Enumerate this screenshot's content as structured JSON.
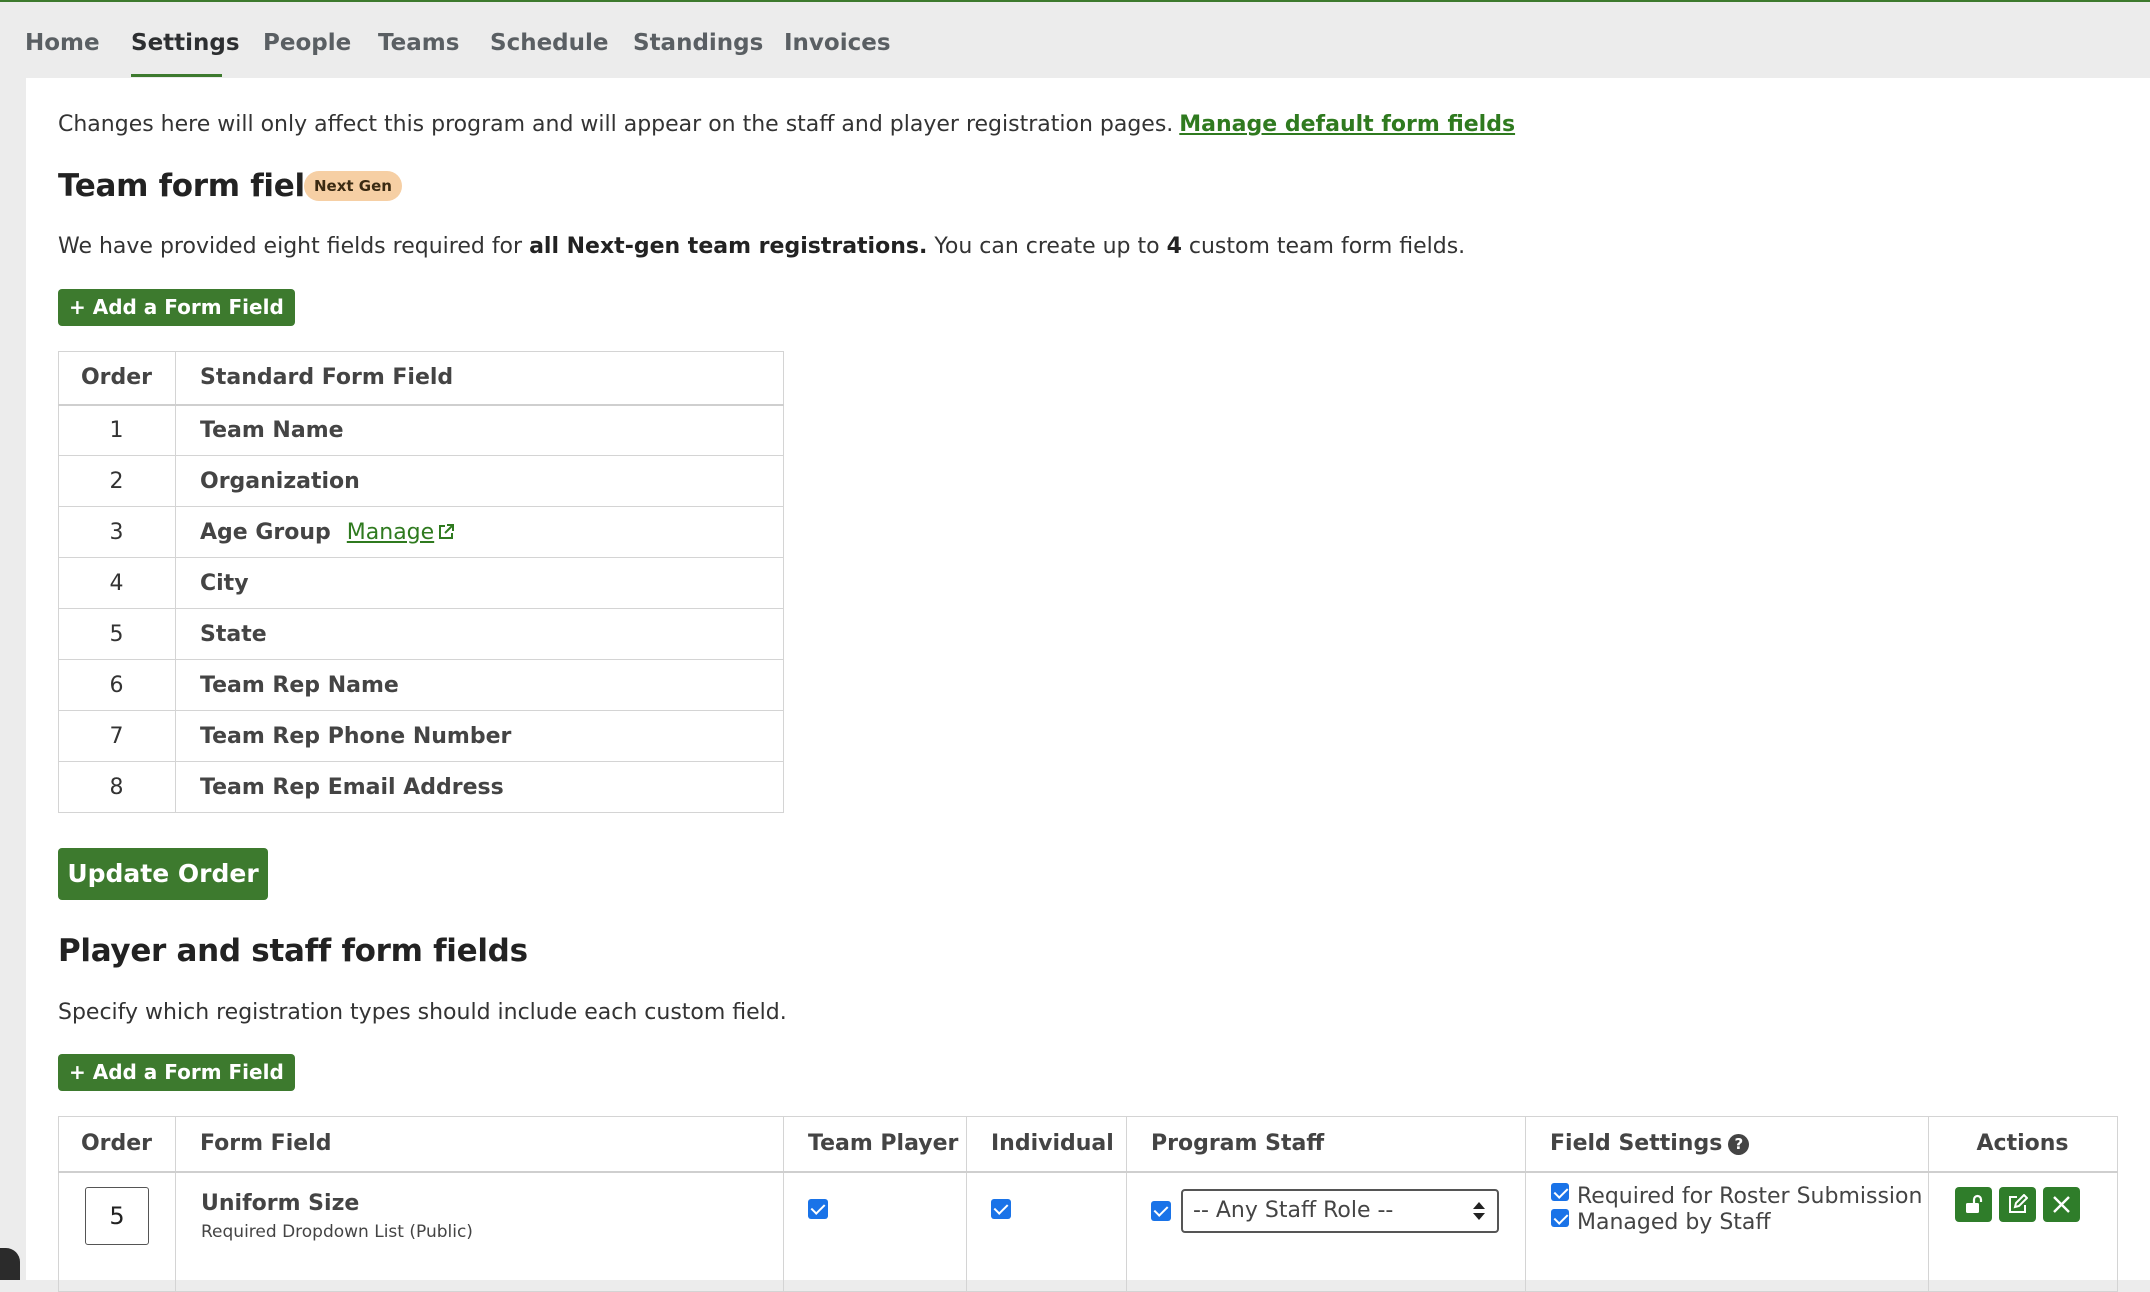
{
  "nav": {
    "tabs": [
      {
        "label": "Home"
      },
      {
        "label": "Settings",
        "active": true
      },
      {
        "label": "People"
      },
      {
        "label": "Teams"
      },
      {
        "label": "Schedule"
      },
      {
        "label": "Standings"
      },
      {
        "label": "Invoices"
      }
    ]
  },
  "intro": {
    "text": "Changes here will only affect this program and will appear on the staff and player registration pages.",
    "link": "Manage default form fields"
  },
  "team_section": {
    "title": "Team form fields",
    "badge": "Next Gen",
    "desc_pre": "We have provided eight fields required for ",
    "desc_bold": "all Next-gen team registrations.",
    "desc_mid": " You can create up to ",
    "desc_count": "4",
    "desc_post": " custom team form fields.",
    "add_button": "+ Add a Form Field",
    "table": {
      "headers": [
        "Order",
        "Standard Form Field"
      ],
      "rows": [
        {
          "order": "1",
          "field": "Team Name"
        },
        {
          "order": "2",
          "field": "Organization"
        },
        {
          "order": "3",
          "field": "Age Group",
          "link": "Manage"
        },
        {
          "order": "4",
          "field": "City"
        },
        {
          "order": "5",
          "field": "State"
        },
        {
          "order": "6",
          "field": "Team Rep Name"
        },
        {
          "order": "7",
          "field": "Team Rep Phone Number"
        },
        {
          "order": "8",
          "field": "Team Rep Email Address"
        }
      ]
    },
    "update_button": "Update Order"
  },
  "player_section": {
    "title": "Player and staff form fields",
    "desc": "Specify which registration types should include each custom field.",
    "add_button": "+ Add a Form Field",
    "table": {
      "headers": [
        "Order",
        "Form Field",
        "Team Player",
        "Individual",
        "Program Staff",
        "Field Settings",
        "Actions"
      ],
      "row": {
        "order": "5",
        "field": "Uniform Size",
        "subtitle": "Required Dropdown List (Public)",
        "team_player_checked": true,
        "individual_checked": true,
        "program_staff_checked": true,
        "staff_role": "-- Any Staff Role --",
        "settings": [
          "Required for Roster Submission",
          "Managed by Staff"
        ]
      }
    }
  },
  "colors": {
    "accent": "#3d7a2e",
    "badge": "#f6cfa4",
    "link": "#2f7a1f",
    "checkbox": "#1a73e8"
  },
  "icons": [
    "external-link-icon",
    "help-icon",
    "unlock-icon",
    "edit-icon",
    "close-icon",
    "select-arrows-icon"
  ]
}
